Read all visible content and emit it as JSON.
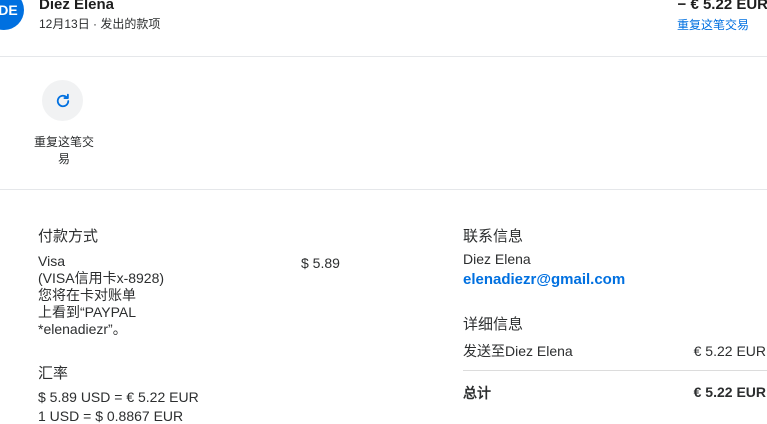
{
  "header": {
    "avatar_initials": "DE",
    "name": "Diez Elena",
    "subtitle": "12月13日 · 发出的款项",
    "amount": "− € 5.22 EUR",
    "repeat_link": "重复这笔交易"
  },
  "actions": {
    "repeat_icon": "refresh-icon",
    "repeat_label": "重复这笔交易"
  },
  "payment": {
    "heading": "付款方式",
    "lines": [
      "Visa",
      "(VISA信用卡x-8928)",
      "您将在卡对账单",
      "上看到“PAYPAL",
      "*elenadiezr”。"
    ],
    "amount": "$ 5.89"
  },
  "exchange": {
    "heading": "汇率",
    "line1": "$ 5.89 USD = € 5.22 EUR",
    "line2": "1 USD = $ 0.8867 EUR"
  },
  "contact": {
    "heading": "联系信息",
    "name": "Diez Elena",
    "email": "elenadiezr@gmail.com"
  },
  "details": {
    "heading": "详细信息",
    "send_to_label": "发送至Diez Elena",
    "send_to_amount": "€ 5.22 EUR",
    "total_label": "总计",
    "total_amount": "€ 5.22 EUR"
  },
  "colors": {
    "accent": "#0070e0"
  }
}
